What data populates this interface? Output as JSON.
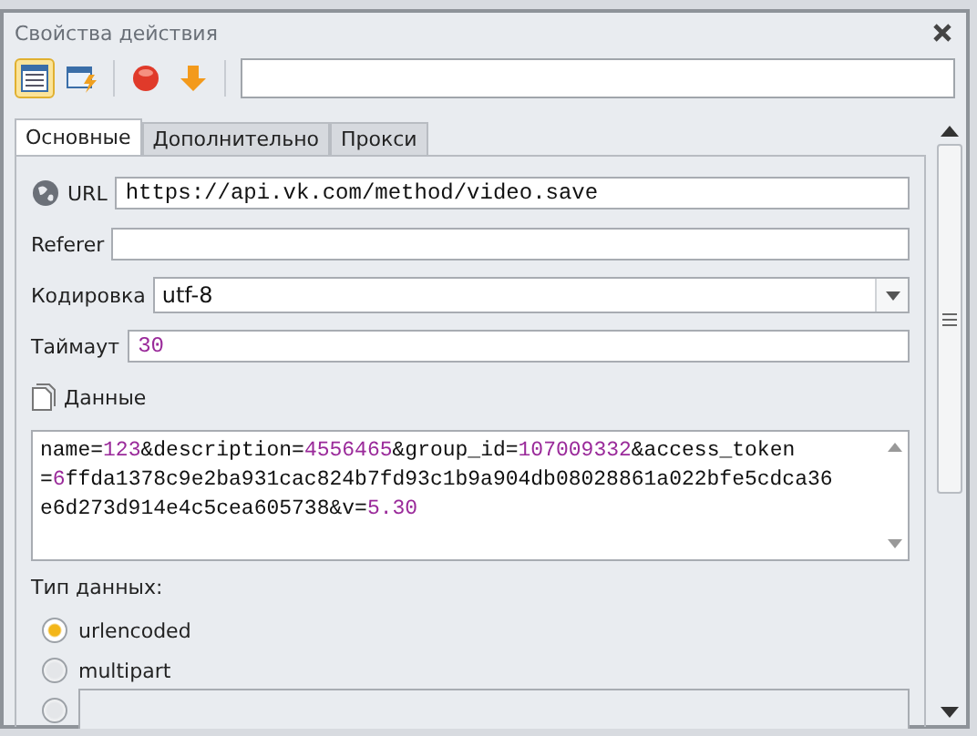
{
  "window": {
    "title": "Свойства действия"
  },
  "toolbar": {
    "buttons": [
      {
        "kind": "table",
        "selected": true
      },
      {
        "kind": "flash",
        "selected": false
      },
      {
        "kind": "stop",
        "selected": false
      },
      {
        "kind": "down",
        "selected": false
      }
    ]
  },
  "tabs": [
    {
      "label": "Основные",
      "selected": true
    },
    {
      "label": "Дополнительно",
      "selected": false
    },
    {
      "label": "Прокси",
      "selected": false
    }
  ],
  "fields": [
    {
      "kind": "url",
      "label": "URL",
      "value": "https://api.vk.com/method/video.save"
    },
    {
      "kind": "text",
      "label": "Referer"
    },
    {
      "kind": "select",
      "label": "Кодировка",
      "value": "utf-8"
    },
    {
      "kind": "number",
      "label": "Таймаут",
      "value": "30"
    }
  ],
  "data": {
    "label": "Данные",
    "lines": [
      [
        {
          "kind": "text",
          "text": "name="
        },
        {
          "kind": "number",
          "text": "123"
        },
        {
          "kind": "text",
          "text": "&description="
        },
        {
          "kind": "number",
          "text": "4556465"
        },
        {
          "kind": "text",
          "text": "&group_id="
        },
        {
          "kind": "number",
          "text": "107009332"
        },
        {
          "kind": "text",
          "text": "&access_token"
        }
      ],
      [
        {
          "kind": "text",
          "text": "="
        },
        {
          "kind": "number",
          "text": "6"
        },
        {
          "kind": "text",
          "text": "ffda1378c9e2ba931cac824b7fd93c1b9a904db08028861a022bfe5cdca36"
        }
      ],
      [
        {
          "kind": "text",
          "text": "e6d273d914e4c5cea605738&v="
        },
        {
          "kind": "number",
          "text": "5.30"
        }
      ]
    ]
  },
  "data_type": {
    "label": "Тип данных:",
    "options": [
      {
        "label": "urlencoded",
        "selected": true,
        "kind": "label"
      },
      {
        "label": "multipart",
        "selected": false,
        "kind": "label"
      },
      {
        "kind": "field",
        "selected": false
      }
    ]
  }
}
